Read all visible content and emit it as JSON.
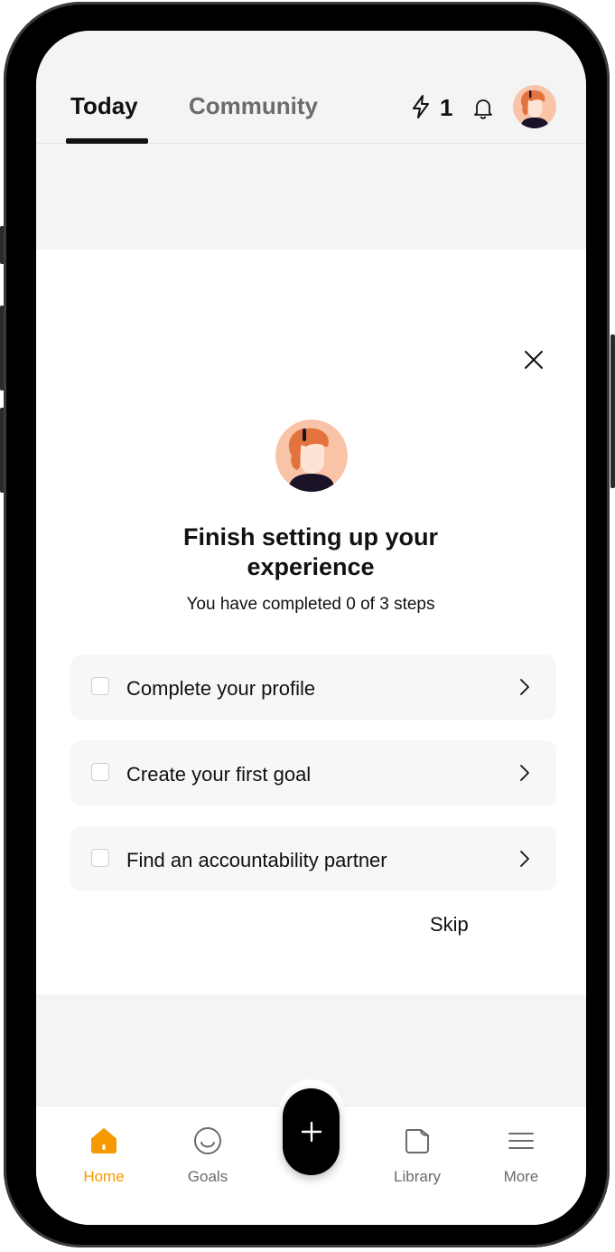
{
  "header": {
    "tabs": [
      {
        "label": "Today",
        "active": true
      },
      {
        "label": "Community",
        "active": false
      }
    ],
    "streak_count": "1",
    "icons": {
      "streak": "bolt-icon",
      "notifications": "bell-icon",
      "profile": "avatar"
    }
  },
  "setup_card": {
    "title": "Finish setting up your experience",
    "subtitle": "You have completed 0 of 3 steps",
    "steps": [
      {
        "label": "Complete your profile",
        "checked": false
      },
      {
        "label": "Create your first goal",
        "checked": false
      },
      {
        "label": "Find an accountability partner",
        "checked": false
      }
    ],
    "skip_label": "Skip",
    "close_icon": "close-icon"
  },
  "bottom_nav": {
    "items": [
      {
        "label": "Home",
        "icon": "home-icon",
        "active": true
      },
      {
        "label": "Goals",
        "icon": "smile-icon",
        "active": false
      },
      {
        "label": "Library",
        "icon": "library-icon",
        "active": false
      },
      {
        "label": "More",
        "icon": "menu-icon",
        "active": false
      }
    ],
    "fab_icon": "plus-icon"
  },
  "colors": {
    "accent": "#f59a00",
    "text": "#111111",
    "muted": "#6b6b6e",
    "avatar_bg": "#f9c3a8",
    "avatar_hair": "#e2733d"
  }
}
